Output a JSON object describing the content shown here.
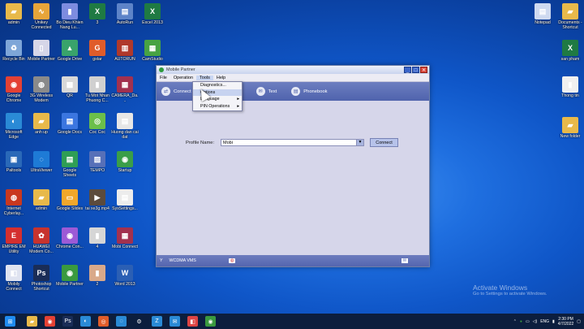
{
  "desktop": {
    "left_icons": [
      {
        "label": "admin",
        "icon": "user-folder-icon",
        "color": "#e8b94a",
        "glyph": "▰"
      },
      {
        "label": "Unikey Connected",
        "icon": "unikey-icon",
        "color": "#e7a53a",
        "glyph": "∿"
      },
      {
        "label": "Bo Dieu Khien Nang Lu...",
        "icon": "document-icon",
        "color": "#7d8ce0",
        "glyph": "▮"
      },
      {
        "label": "3",
        "icon": "excel-icon",
        "color": "#1f7a43",
        "glyph": "X"
      },
      {
        "label": "AutoRun",
        "icon": "autorun-icon",
        "color": "#5d84c8",
        "glyph": "▤"
      },
      {
        "label": "Excel 2013",
        "icon": "excel-icon",
        "color": "#1f7a43",
        "glyph": "X"
      },
      {
        "label": "Recycle Bin",
        "icon": "recycle-bin-icon",
        "color": "#7ea6d8",
        "glyph": "♻"
      },
      {
        "label": "Mobile Partner",
        "icon": "mobile-partner-icon",
        "color": "#d6d6e8",
        "glyph": "▯"
      },
      {
        "label": "Google Drive",
        "icon": "google-drive-icon",
        "color": "#39a36b",
        "glyph": "▲"
      },
      {
        "label": "gstar",
        "icon": "gstar-icon",
        "color": "#e05c2a",
        "glyph": "G"
      },
      {
        "label": "AUTORUN",
        "icon": "autorun-icon",
        "color": "#b0392b",
        "glyph": "▥"
      },
      {
        "label": "CamStudio",
        "icon": "camstudio-icon",
        "color": "#48a343",
        "glyph": "▦"
      },
      {
        "label": "Google Chrome",
        "icon": "chrome-icon",
        "color": "#e44134",
        "glyph": "◉"
      },
      {
        "label": "3G Wireless Modem",
        "icon": "modem-icon",
        "color": "#8a8a8a",
        "glyph": "◍"
      },
      {
        "label": "QR",
        "icon": "qr-icon",
        "color": "#d8d8d8",
        "glyph": "▩"
      },
      {
        "label": "Tu Mot Nhan Phuong C...",
        "icon": "document-icon",
        "color": "#d0d0d0",
        "glyph": "▮"
      },
      {
        "label": "CAMERA_Da...",
        "icon": "winrar-icon",
        "color": "#a2314f",
        "glyph": "▦"
      },
      {
        "label": "Microsoft Edge",
        "icon": "edge-icon",
        "color": "#2a8ad6",
        "glyph": "◐"
      },
      {
        "label": "anh up",
        "icon": "folder-icon",
        "color": "#e8b94a",
        "glyph": "▰"
      },
      {
        "label": "Google Docs",
        "icon": "google-docs-icon",
        "color": "#3b76e0",
        "glyph": "▤"
      },
      {
        "label": "Coc Coc",
        "icon": "coccoc-icon",
        "color": "#6bbf4a",
        "glyph": "◎"
      },
      {
        "label": "Huong dan cai dat",
        "icon": "document-icon",
        "color": "#e6e6e6",
        "glyph": "▤"
      },
      {
        "label": "Paltools",
        "icon": "paltools-icon",
        "color": "#2a69b8",
        "glyph": "▣"
      },
      {
        "label": "UltraViewer",
        "icon": "ultraviewer-icon",
        "color": "#1e7bd6",
        "glyph": "◌"
      },
      {
        "label": "Google Sheets",
        "icon": "google-sheets-icon",
        "color": "#2f9e55",
        "glyph": "▤"
      },
      {
        "label": "TEMPO",
        "icon": "tempo-icon",
        "color": "#5770b8",
        "glyph": "▧"
      },
      {
        "label": "Startup",
        "icon": "startup-icon",
        "color": "#3a9e48",
        "glyph": "◉"
      },
      {
        "label": "Internet Cyberlay...",
        "icon": "internet-icon",
        "color": "#c9381f",
        "glyph": "◍"
      },
      {
        "label": "admin",
        "icon": "user-folder-icon",
        "color": "#e8b94a",
        "glyph": "▰"
      },
      {
        "label": "Google Slides",
        "icon": "google-slides-icon",
        "color": "#f1a72a",
        "glyph": "▭"
      },
      {
        "label": "tai xe3g.mp4",
        "icon": "video-icon",
        "color": "#5c4b3c",
        "glyph": "▶"
      },
      {
        "label": "SysSettings...",
        "icon": "document-icon",
        "color": "#ececec",
        "glyph": "▤"
      },
      {
        "label": "EMPIRE EM Utility",
        "icon": "empire-icon",
        "color": "#d42f2f",
        "glyph": "E"
      },
      {
        "label": "HUAWEI Modem Co...",
        "icon": "huawei-icon",
        "color": "#c7332e",
        "glyph": "✿"
      },
      {
        "label": "Chrome Con...",
        "icon": "chrome-icon",
        "color": "#9c5ad6",
        "glyph": "◉"
      },
      {
        "label": "4",
        "icon": "document-icon",
        "color": "#d6d6d6",
        "glyph": "▮"
      },
      {
        "label": "Mobi Connect",
        "icon": "winrar-icon",
        "color": "#a2314f",
        "glyph": "▦"
      },
      {
        "label": "Mobily Connect",
        "icon": "mobily-icon",
        "color": "#dfe3f0",
        "glyph": "◧"
      },
      {
        "label": "Photoshop Shortcut",
        "icon": "photoshop-icon",
        "color": "#1a2d57",
        "glyph": "Ps"
      },
      {
        "label": "Mobile Partner",
        "icon": "mobile-partner-icon",
        "color": "#3a9a3f",
        "glyph": "◉"
      },
      {
        "label": "2",
        "icon": "image-icon",
        "color": "#d9a98a",
        "glyph": "▮"
      },
      {
        "label": "Word 2013",
        "icon": "word-icon",
        "color": "#2b5fb4",
        "glyph": "W"
      }
    ],
    "right_icons": [
      {
        "label": "Notepad",
        "icon": "notepad-icon",
        "color": "#cfdaf0",
        "glyph": "▤"
      },
      {
        "label": "Documents - Shortcut",
        "icon": "documents-icon",
        "color": "#e8b94a",
        "glyph": "▰"
      },
      {
        "label": "san pham",
        "icon": "excel-icon",
        "color": "#1f7a43",
        "glyph": "X"
      },
      {
        "label": "Thong tin",
        "icon": "document-icon",
        "color": "#f0f0f0",
        "glyph": "▮"
      },
      {
        "label": "New folder",
        "icon": "folder-icon",
        "color": "#e8b94a",
        "glyph": "▰"
      }
    ]
  },
  "window": {
    "title": "Mobile Partner",
    "menu": [
      "File",
      "Operation",
      "Tools",
      "Help"
    ],
    "active_menu": "Tools",
    "toolbar": [
      {
        "label": "Connect",
        "icon": "connect-icon"
      },
      {
        "label": "Text",
        "icon": "text-message-icon"
      },
      {
        "label": "Phonebook",
        "icon": "phonebook-icon"
      }
    ],
    "tools_menu": [
      {
        "label": "Diagnostics...",
        "submenu": false
      },
      {
        "label": "Options",
        "submenu": false
      },
      {
        "label": "Language",
        "submenu": true
      },
      {
        "label": "PIN Operations",
        "submenu": true
      }
    ],
    "profile_label": "Profile Name:",
    "profile_value": "Mobi",
    "connect_button": "Connect",
    "status": "WCDMA  VMS"
  },
  "watermark": {
    "line1": "Activate Windows",
    "line2": "Go to Settings to activate Windows."
  },
  "taskbar": {
    "items": [
      {
        "icon": "windows-start-icon",
        "color": "#1f8bf0",
        "glyph": "⊞"
      },
      {
        "icon": "file-explorer-icon",
        "color": "#e8b94a",
        "glyph": "▰"
      },
      {
        "icon": "chrome-icon",
        "color": "#e44134",
        "glyph": "◉"
      },
      {
        "icon": "photoshop-icon",
        "color": "#1a2d57",
        "glyph": "Ps"
      },
      {
        "icon": "edge-icon",
        "color": "#2a8ad6",
        "glyph": "◐"
      },
      {
        "icon": "coccoc-icon",
        "color": "#e05c2a",
        "glyph": "◎"
      },
      {
        "icon": "messenger-icon",
        "color": "#2a8ad6",
        "glyph": "◌"
      },
      {
        "icon": "settings-icon",
        "color": "#0c1e3e",
        "glyph": "⚙"
      },
      {
        "icon": "zalo-icon",
        "color": "#2a8ad6",
        "glyph": "Z"
      },
      {
        "icon": "mail-icon",
        "color": "#2a8ad6",
        "glyph": "✉"
      },
      {
        "icon": "camstudio-icon",
        "color": "#d44",
        "glyph": "◧"
      },
      {
        "icon": "mobile-partner-icon",
        "color": "#3a9a3f",
        "glyph": "◉"
      }
    ],
    "tray_lang": "ENG",
    "time": "2:30 PM",
    "date": "4/7/2022"
  }
}
